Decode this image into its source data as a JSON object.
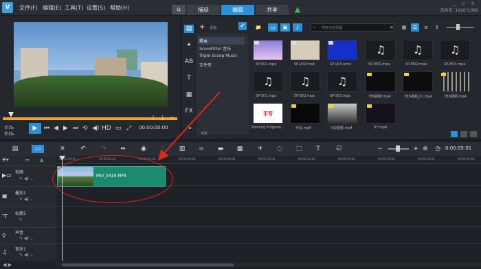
{
  "menubar": {
    "items": [
      "文件(F)",
      "编辑(E)",
      "工具(T)",
      "设置(S)",
      "帮助(H)"
    ],
    "tabs": [
      "捕获",
      "编辑",
      "共享"
    ],
    "active_tab": "编辑",
    "resolution": "未命名, 1920*1080"
  },
  "player": {
    "mode_project": "项目▸",
    "mode_clip": "素材▸",
    "hd_label": "HD",
    "timecode": "00:00:00:00"
  },
  "library": {
    "add_label": "添加",
    "search_placeholder": "搜索当前视图",
    "browse_label": "浏览",
    "folders": [
      "样本",
      "ScoreFitter 音乐",
      "Triple Scoop Music",
      "文件夹"
    ],
    "thumbs_row1": [
      "SP-V01.mp4",
      "SP-V02.mp4",
      "SP-V04.wmv",
      "SP-M01.mpa",
      "SP-M02.mpa",
      "SP-M03.mpa"
    ],
    "thumbs_row2": [
      "SP-S01.mpa",
      "SP-S02.mpa",
      "SP-S03.mpa",
      "7B8视频.mp4",
      "7B8视频_01.mp4",
      "7B8视频.mp4"
    ],
    "thumbs_row3": [
      "Painting Program...",
      "手写.mp4",
      "QQ视频.mp4",
      "07.mp4"
    ],
    "handwrite_text": "手写"
  },
  "timeline": {
    "timecode": "0:00:05:01",
    "ruler": [
      "00:00:00:00",
      "00:00:02:00",
      "00:00:04:00",
      "00:00:06:00",
      "00:00:08:00",
      "00:00:10:00",
      "00:00:12:00",
      "00:00:14:00",
      "00:00:16:00",
      "00:00:18:00",
      "00:00:20:00"
    ],
    "tracks": [
      "视频",
      "叠加1",
      "标题1",
      "声音",
      "音乐1"
    ],
    "clip_label": "MVI_0419.MP4"
  },
  "colors": {
    "accent": "#2f8fd3",
    "clip": "#1b8a6e",
    "annotation": "#e1261c",
    "scrub": "#f0a71c"
  }
}
